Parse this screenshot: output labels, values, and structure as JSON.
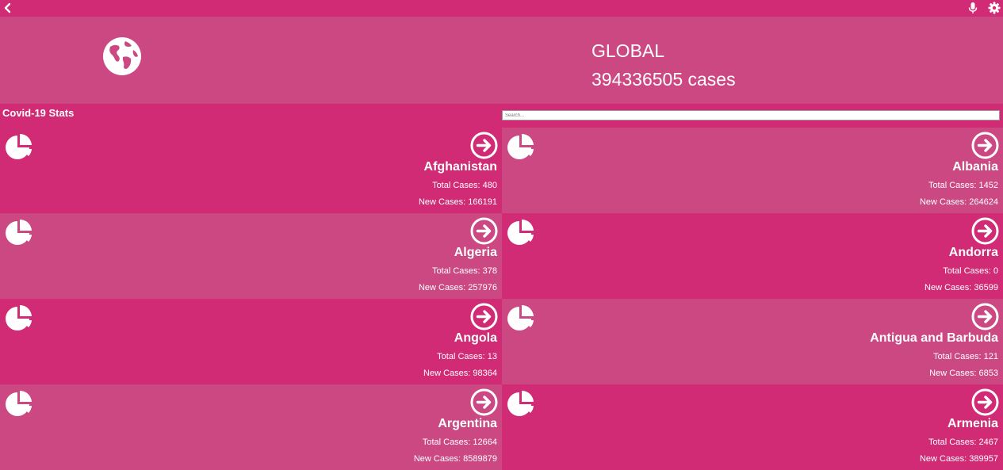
{
  "topbar": {
    "back_icon": "chevron-left-icon",
    "mic_icon": "microphone-icon",
    "settings_icon": "gear-icon"
  },
  "hero": {
    "icon": "globe-icon",
    "title": "GLOBAL",
    "cases": "394336505 cases"
  },
  "section_title": "Covid-19 Stats",
  "search": {
    "placeholder": "Search..."
  },
  "countries": [
    {
      "name": "Afghanistan",
      "total": "Total Cases: 480",
      "new": "New Cases: 166191"
    },
    {
      "name": "Albania",
      "total": "Total Cases: 1452",
      "new": "New Cases: 264624"
    },
    {
      "name": "Algeria",
      "total": "Total Cases: 378",
      "new": "New Cases: 257976"
    },
    {
      "name": "Andorra",
      "total": "Total Cases: 0",
      "new": "New Cases: 36599"
    },
    {
      "name": "Angola",
      "total": "Total Cases: 13",
      "new": "New Cases: 98364"
    },
    {
      "name": "Antigua and Barbuda",
      "total": "Total Cases: 121",
      "new": "New Cases: 6853"
    },
    {
      "name": "Argentina",
      "total": "Total Cases: 12664",
      "new": "New Cases: 8589879"
    },
    {
      "name": "Armenia",
      "total": "Total Cases: 2467",
      "new": "New Cases: 389957"
    }
  ],
  "colors": {
    "primary": "#d12b75",
    "secondary": "#cc4882",
    "text": "#ffffff"
  },
  "card_icons": {
    "chart": "pie-chart-icon",
    "open": "arrow-right-circle-icon"
  }
}
